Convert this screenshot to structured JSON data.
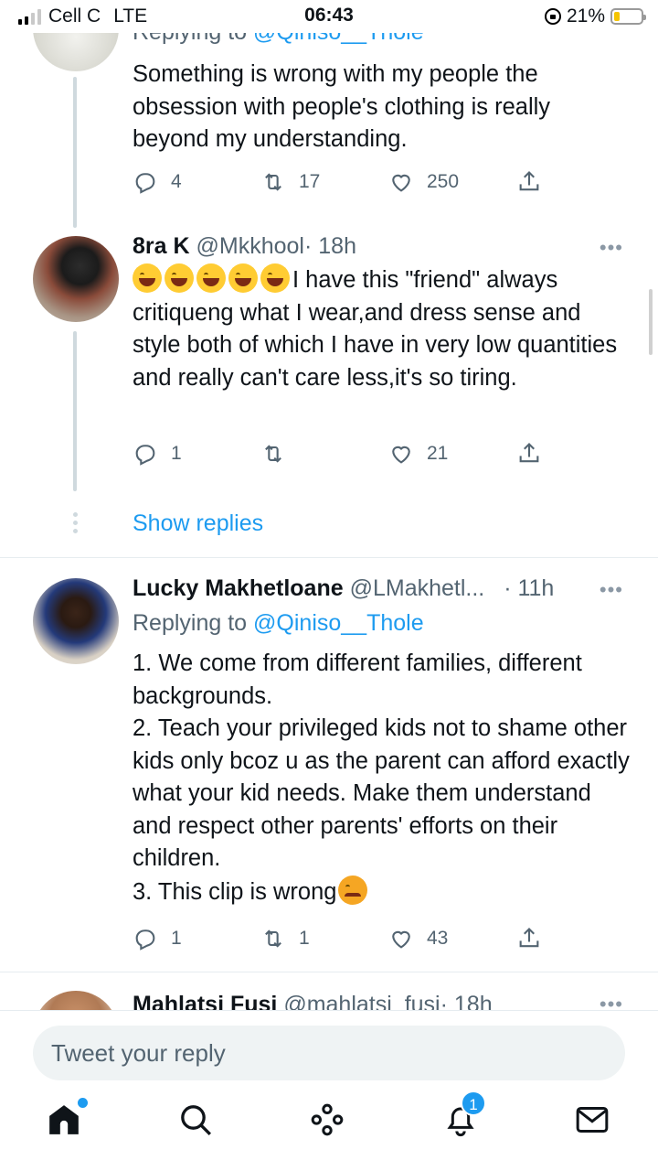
{
  "status_bar": {
    "carrier": "Cell C",
    "network": "LTE",
    "time": "06:43",
    "battery": "21%",
    "battery_level": 0.21
  },
  "tweets": [
    {
      "reply_to_label": "Replying to",
      "reply_to_handle": "@Qiniso__Thole",
      "text": "Something is wrong with my people the obsession with people's clothing is really beyond my understanding.",
      "replies": "4",
      "retweets": "17",
      "likes": "250"
    },
    {
      "name": "8ra K",
      "handle": "@Mkkhool",
      "time": "· 18h",
      "more": "•••",
      "emojis": [
        "rofl-emoji",
        "sweat-smile-emoji",
        "sweat-smile-emoji",
        "joy-emoji",
        "joy-emoji"
      ],
      "text": "I have this \"friend\" always critiqueng what I wear,and dress sense and style both of which I have in very low quantities and really can't care less,it's so tiring.",
      "replies": "1",
      "retweets": "",
      "likes": "21"
    },
    {
      "name": "Lucky Makhetloane",
      "handle": "@LMakhetl...",
      "time": "· 11h",
      "more": "•••",
      "reply_to_label": "Replying to",
      "reply_to_handle": "@Qiniso__Thole",
      "lines": [
        "1. We come from different families, different backgrounds.",
        "2. Teach your privileged kids not to shame other kids only bcoz u as the parent can afford exactly what your kid needs. Make them understand and respect other parents' efforts on their children.",
        "3. This clip is wrong"
      ],
      "end_emoji": "angry-face-emoji",
      "replies": "1",
      "retweets": "1",
      "likes": "43"
    },
    {
      "name": "Mahlatsi Fusi",
      "handle": "@mahlatsi_fusi",
      "time": "· 18h",
      "more": "•••"
    }
  ],
  "show_replies": "Show replies",
  "reply_box": {
    "placeholder": "Tweet your reply"
  },
  "tab_bar": {
    "items": [
      "home",
      "search",
      "spaces",
      "notifications",
      "messages"
    ],
    "notification_count": "1",
    "accent": "#1d9bf0"
  }
}
